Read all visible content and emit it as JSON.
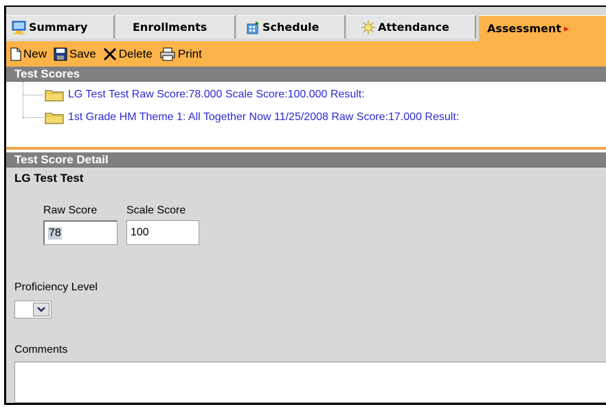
{
  "tabs": [
    {
      "label": "Summary",
      "icon": "summary-icon"
    },
    {
      "label": "Enrollments",
      "icon": ""
    },
    {
      "label": "Schedule",
      "icon": "schedule-icon"
    },
    {
      "label": "Attendance",
      "icon": "attendance-icon"
    },
    {
      "label": "Assessment",
      "icon": "",
      "active": true
    }
  ],
  "toolbar": {
    "new_label": "New",
    "save_label": "Save",
    "delete_label": "Delete",
    "print_label": "Print"
  },
  "test_scores": {
    "header": "Test Scores",
    "items": [
      "LG Test Test Raw Score:78.000 Scale Score:100.000 Result:",
      "1st Grade HM Theme 1: All Together Now 11/25/2008 Raw Score:17.000 Result:"
    ]
  },
  "detail": {
    "header": "Test Score Detail",
    "test_name": "LG Test Test",
    "raw_score_label": "Raw Score",
    "raw_score_value": "78",
    "scale_score_label": "Scale Score",
    "scale_score_value": "100",
    "proficiency_label": "Proficiency Level",
    "proficiency_value": "",
    "comments_label": "Comments",
    "comments_value": ""
  },
  "colors": {
    "accent": "#fbb34a",
    "header_gray": "#808080",
    "link_blue": "#2a2ad4"
  }
}
